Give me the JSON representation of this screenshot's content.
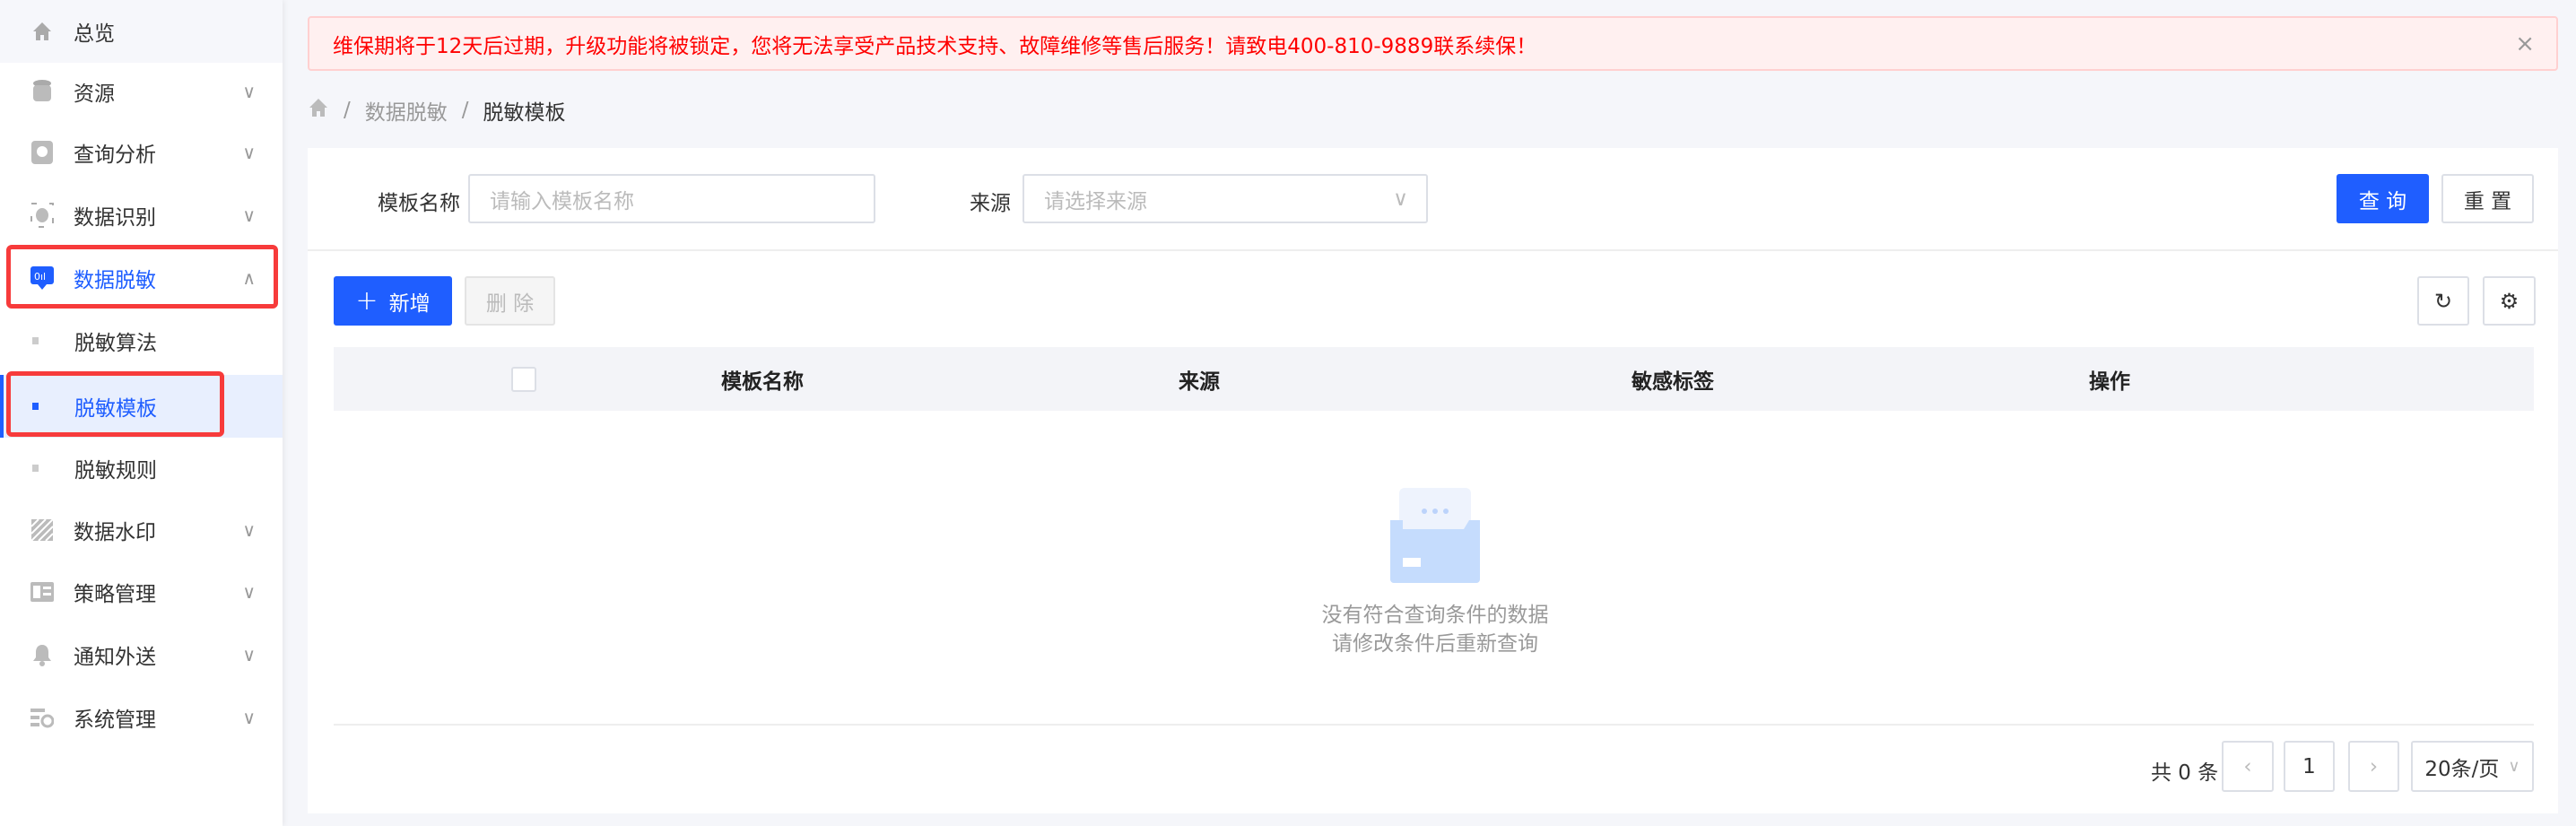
{
  "sidebar": {
    "items": [
      {
        "label": "总览",
        "icon": "home-icon"
      },
      {
        "label": "资源",
        "icon": "database-icon"
      },
      {
        "label": "查询分析",
        "icon": "query-icon"
      },
      {
        "label": "数据识别",
        "icon": "scan-icon"
      },
      {
        "label": "数据脱敏",
        "icon": "mask-icon"
      },
      {
        "label": "脱敏算法"
      },
      {
        "label": "脱敏模板"
      },
      {
        "label": "脱敏规则"
      },
      {
        "label": "数据水印",
        "icon": "watermark-icon"
      },
      {
        "label": "策略管理",
        "icon": "policy-icon"
      },
      {
        "label": "通知外送",
        "icon": "bell-icon"
      },
      {
        "label": "系统管理",
        "icon": "settings-icon"
      }
    ]
  },
  "alert": {
    "text": "维保期将于12天后过期，升级功能将被锁定，您将无法享受产品技术支持、故障维修等售后服务！请致电400-810-9889联系续保！"
  },
  "breadcrumb": {
    "items": [
      "数据脱敏",
      "脱敏模板"
    ],
    "sep": "/"
  },
  "filter": {
    "name_label": "模板名称",
    "name_placeholder": "请输入模板名称",
    "source_label": "来源",
    "source_placeholder": "请选择来源",
    "query": "查 询",
    "reset": "重 置"
  },
  "toolbar": {
    "add": "新增",
    "delete": "删 除"
  },
  "table": {
    "columns": [
      "模板名称",
      "来源",
      "敏感标签",
      "操作"
    ],
    "rows": []
  },
  "empty": {
    "line1": "没有符合查询条件的数据",
    "line2": "请修改条件后重新查询"
  },
  "pagination": {
    "total": "共 0 条",
    "page": "1",
    "size": "20条/页"
  },
  "colors": {
    "accent": "#1f5eff",
    "alert": "#ff0000",
    "highlight": "#f73b3b"
  }
}
